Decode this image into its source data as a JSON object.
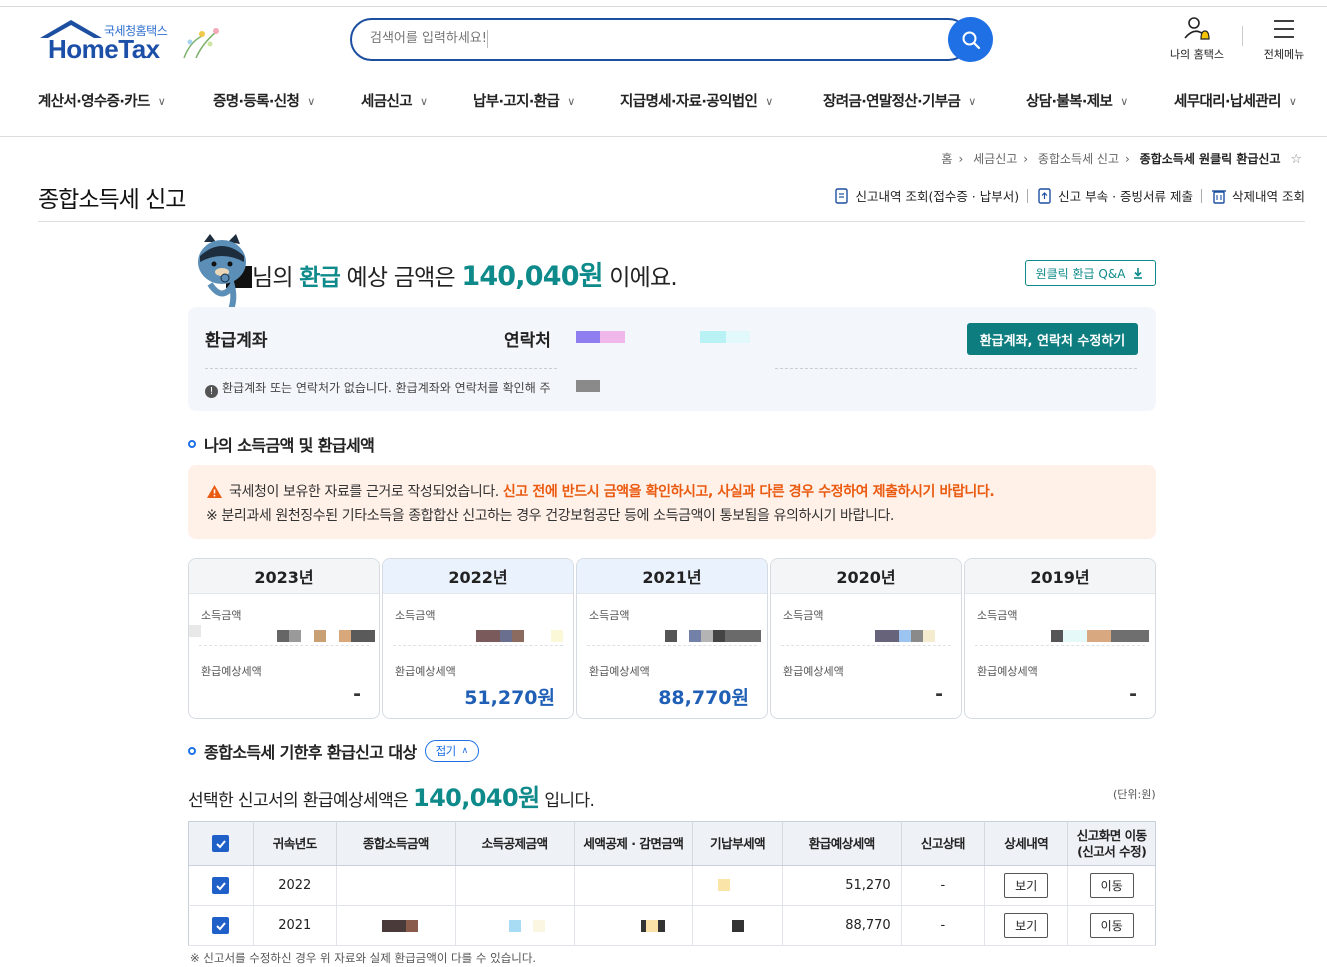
{
  "header": {
    "logo_sub": "국세청홈택스",
    "logo_main": "HomeTax",
    "search_placeholder": "검색어를 입력하세요!",
    "my_hometax": "나의 홈택스",
    "all_menu": "전체메뉴"
  },
  "gnb": [
    "계산서·영수증·카드",
    "증명·등록·신청",
    "세금신고",
    "납부·고지·환급",
    "지급명세·자료·공익법인",
    "장려금·연말정산·기부금",
    "상담·불복·제보",
    "세무대리·납세관리"
  ],
  "breadcrumb": [
    "홈",
    "세금신고",
    "종합소득세 신고",
    "종합소득세 원클릭 환급신고"
  ],
  "page": {
    "title": "종합소득세 신고",
    "actions": [
      "신고내역 조회(접수증 · 납부서)",
      "신고 부속 · 증빙서류 제출",
      "삭제내역 조회"
    ]
  },
  "summary": {
    "prefix": "님의",
    "refund_word": "환급",
    "middle": "예상 금액은",
    "amount": "140,040원",
    "suffix": "이에요.",
    "qa_button": "원클릭 환급 Q&A"
  },
  "account": {
    "bank_label": "환급계좌",
    "contact_label": "연락처",
    "note": "환급계좌 또는 연락처가 없습니다. 환급계좌와 연락처를 확인해 주",
    "edit_button": "환급계좌, 연락처 수정하기"
  },
  "section1": {
    "title": "나의 소득금액 및 환급세액",
    "warn_normal": "국세청이 보유한 자료를 근거로 작성되었습니다.",
    "warn_highlight": "신고 전에 반드시 금액을 확인하시고, 사실과 다른 경우 수정하여 제출하시기 바랍니다.",
    "warn_note": "※ 분리과세 원천징수된 기타소득을 종합합산 신고하는 경우 건강보험공단 등에 소득금액이 통보됨을 유의하시기 바랍니다."
  },
  "years": [
    {
      "year": "2023년",
      "income_label": "소득금액",
      "refund_label": "환급예상세액",
      "refund": "-",
      "selected": false
    },
    {
      "year": "2022년",
      "income_label": "소득금액",
      "refund_label": "환급예상세액",
      "refund": "51,270원",
      "selected": true
    },
    {
      "year": "2021년",
      "income_label": "소득금액",
      "refund_label": "환급예상세액",
      "refund": "88,770원",
      "selected": true
    },
    {
      "year": "2020년",
      "income_label": "소득금액",
      "refund_label": "환급예상세액",
      "refund": "-",
      "selected": false
    },
    {
      "year": "2019년",
      "income_label": "소득금액",
      "refund_label": "환급예상세액",
      "refund": "-",
      "selected": false
    }
  ],
  "section2": {
    "title": "종합소득세 기한후 환급신고 대상",
    "fold_button": "접기",
    "sum_prefix": "선택한 신고서의 환급예상세액은",
    "sum_amount": "140,040원",
    "sum_suffix": "입니다.",
    "unit": "(단위:원)"
  },
  "table": {
    "headers": [
      "귀속년도",
      "종합소득금액",
      "소득공제금액",
      "세액공제 · 감면금액",
      "기납부세액",
      "환급예상세액",
      "신고상태",
      "상세내역",
      "신고화면 이동\n(신고서 수정)"
    ],
    "rows": [
      {
        "year": "2022",
        "refund": "51,270",
        "status": "-",
        "detail": "보기",
        "move": "이동"
      },
      {
        "year": "2021",
        "refund": "88,770",
        "status": "-",
        "detail": "보기",
        "move": "이동"
      }
    ],
    "note": "※ 신고서를 수정하신 경우 위 자료와 실제 환급금액이 다를 수 있습니다."
  },
  "colors": {
    "accent": "#0e8a8a",
    "brand": "#1d4fa0",
    "warn": "#ea5a10"
  }
}
